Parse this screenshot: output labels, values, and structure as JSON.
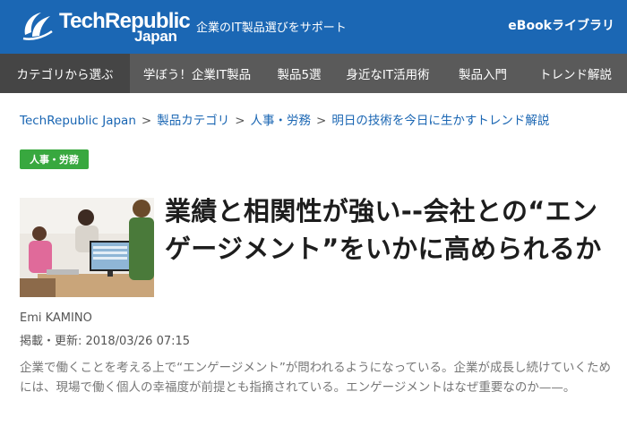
{
  "header": {
    "logo_text": "TechRepublic",
    "logo_sub": "Japan",
    "tagline": "企業のIT製品選びをサポート",
    "ebook_link": "eBookライブラリ",
    "bg_color": "#1b67b4"
  },
  "nav": {
    "items": [
      {
        "label": "カテゴリから選ぶ",
        "active": true
      },
      {
        "label": "学ぼう！企業IT製品"
      },
      {
        "label": "製品5選"
      },
      {
        "label": "身近なIT活用術"
      },
      {
        "label": "製品入門"
      },
      {
        "label": "トレンド解説"
      }
    ]
  },
  "breadcrumb": {
    "items": [
      "TechRepublic Japan",
      "製品カテゴリ",
      "人事・労務",
      "明日の技術を今日に生かすトレンド解説"
    ],
    "separator": ">"
  },
  "article": {
    "category_badge": "人事・労務",
    "badge_color": "#38a83f",
    "title": "業績と相関性が強い--会社との“エンゲージメント”をいかに高められるか",
    "author": "Emi KAMINO",
    "date_label": "掲載・更新: 2018/03/26 07:15",
    "lead": "企業で働くことを考える上で“エンゲージメント”が問われるようになっている。企業が成長し続けていくためには、現場で働く個人の幸福度が前提とも指摘されている。エンゲージメントはなぜ重要なのか——。"
  }
}
